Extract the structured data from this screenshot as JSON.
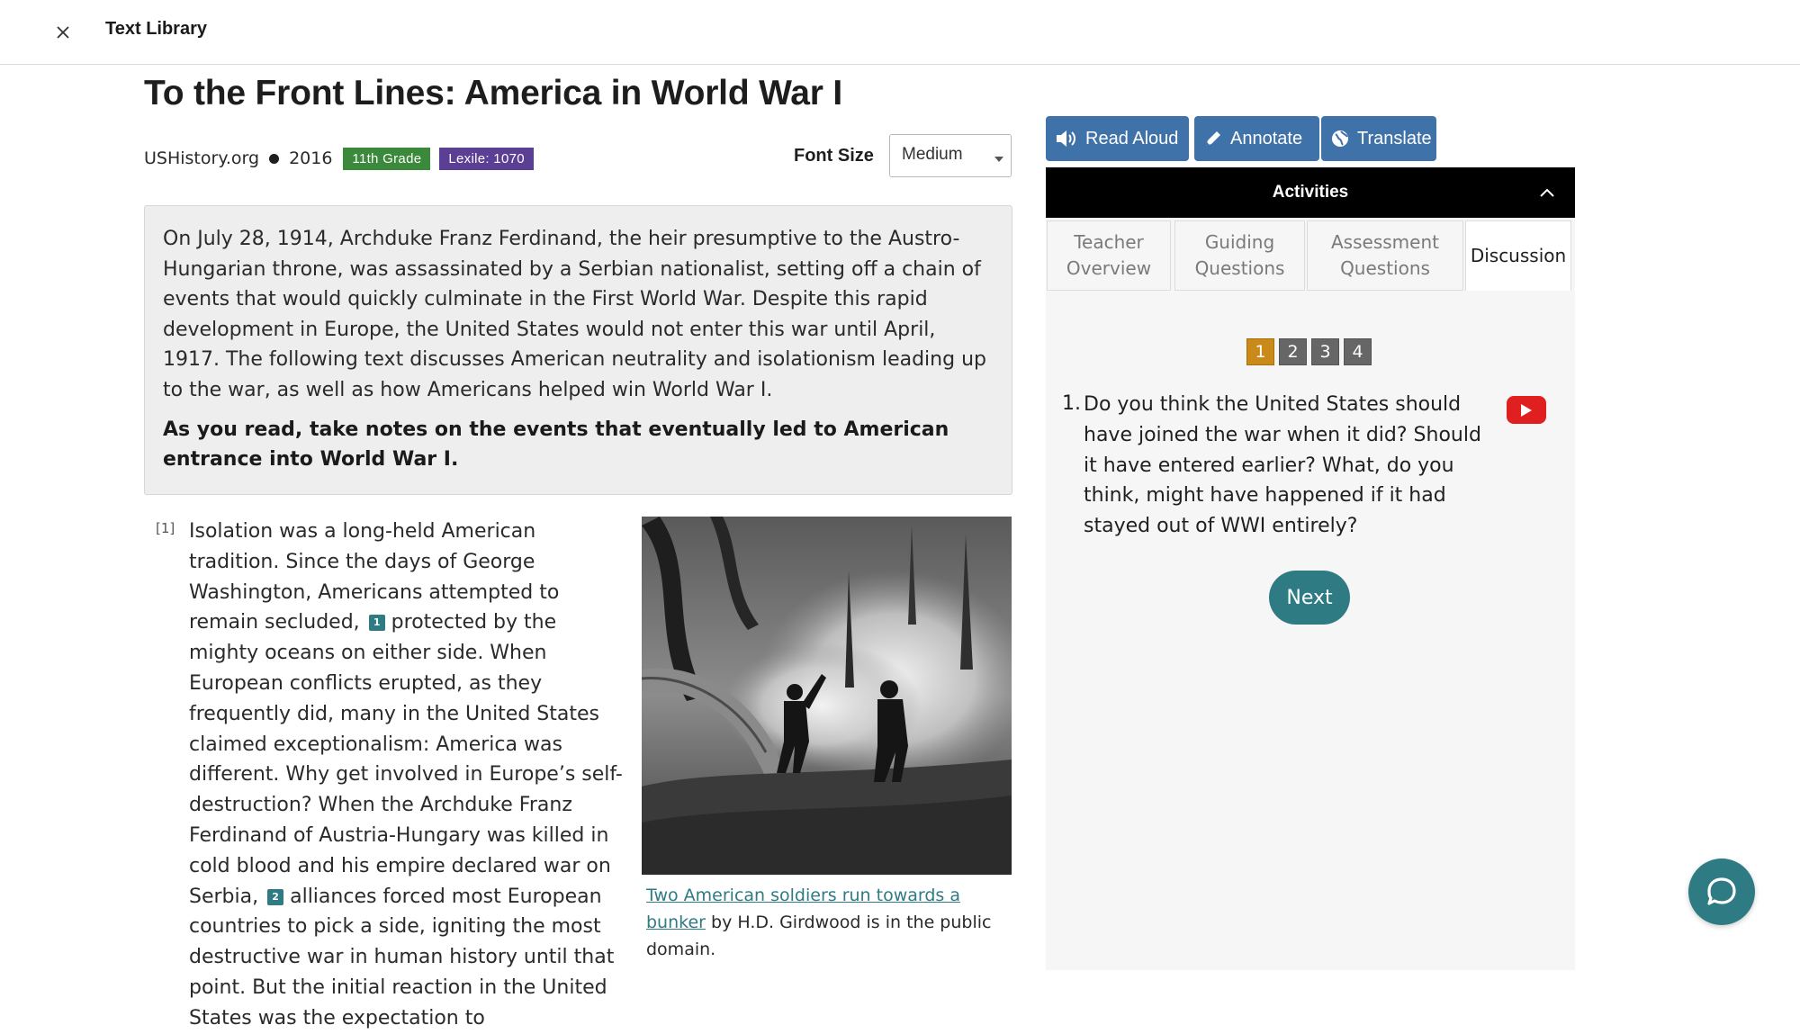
{
  "topbar": {
    "title": "Text Library",
    "close_icon": "close-icon"
  },
  "article": {
    "title": "To the Front Lines: America in World War I",
    "source": "USHistory.org",
    "year": "2016",
    "grade_badge": "11th Grade",
    "lexile_badge": "Lexile: 1070",
    "font_size_label": "Font Size",
    "font_size_value": "Medium",
    "intro": "On July 28, 1914, Archduke Franz Ferdinand, the heir presumptive to the Austro-Hungarian throne, was assassinated by a Serbian nationalist, setting off a chain of events that would quickly culminate in the First World War. Despite this rapid development in Europe, the United States would not enter this war until April, 1917. The following text discusses American neutrality and isolationism leading up to the war, as well as how Americans helped win World War I.",
    "intro_instruction": "As you read, take notes on the events that eventually led to American entrance into World War I.",
    "paragraph_number": "[1]",
    "paragraph": {
      "part1": "Isolation was a long-held American tradition. Since the days of George Washington, Americans attempted to remain secluded,",
      "footnote1": "1",
      "part2": " protected by the mighty oceans on either side. When European conflicts erupted, as they frequently did, many in the United States claimed exceptionalism: America was different. Why get involved in Europe’s self-destruction? When the Archduke Franz Ferdinand of Austria-Hungary was killed in cold blood and his empire declared war on Serbia,",
      "footnote2": "2",
      "part3": " alliances forced most European countries to pick a side, igniting the most destructive war in human history until that point. But the initial reaction in the United States was the expectation to"
    },
    "caption_link": "Two American soldiers run towards a bunker",
    "caption_rest": " by H.D. Girdwood is in the public domain."
  },
  "tools": {
    "read_aloud": "Read Aloud",
    "annotate": "Annotate",
    "translate": "Translate"
  },
  "activities": {
    "title": "Activities",
    "tabs": [
      {
        "label": "Teacher Overview",
        "active": false
      },
      {
        "label": "Guiding Questions",
        "active": false
      },
      {
        "label": "Assessment Questions",
        "active": false
      },
      {
        "label": "Discussion",
        "active": true
      }
    ],
    "pages": [
      "1",
      "2",
      "3",
      "4"
    ],
    "current_page": "1",
    "question_number": "1.",
    "question": "Do you think the United States should have joined the war when it did? Should it have entered earlier? What, do you think, might have happened if it had stayed out of WWI entirely?",
    "next_label": "Next"
  },
  "colors": {
    "accent_teal": "#2e7b84",
    "tool_blue": "#3f72a8",
    "grade_green": "#3b8a3b",
    "lexile_purple": "#5b3f94",
    "page_active": "#c98a1a"
  }
}
